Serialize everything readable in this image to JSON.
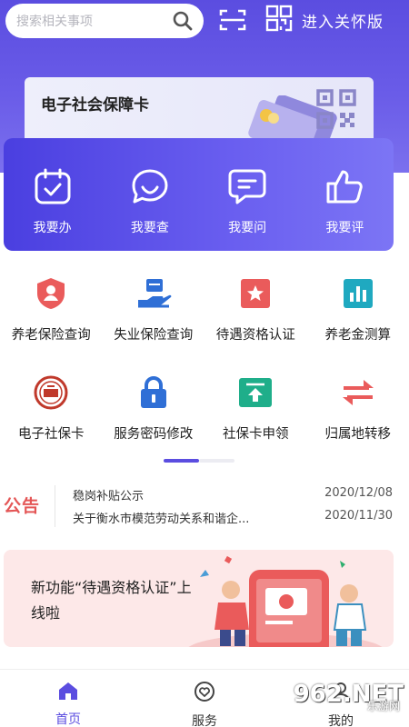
{
  "header": {
    "search_placeholder": "搜索相关事项",
    "care_mode_label": "进入关怀版"
  },
  "card": {
    "title": "电子社会保障卡"
  },
  "actions": [
    {
      "label": "我要办",
      "icon": "calendar-check-icon"
    },
    {
      "label": "我要查",
      "icon": "search-chat-icon"
    },
    {
      "label": "我要问",
      "icon": "message-icon"
    },
    {
      "label": "我要评",
      "icon": "thumbs-up-icon"
    }
  ],
  "services": [
    {
      "label": "养老保险查询",
      "icon": "shield-person-icon",
      "color": "#ea5b5b"
    },
    {
      "label": "失业保险查询",
      "icon": "hand-card-icon",
      "color": "#2f6fd6"
    },
    {
      "label": "待遇资格认证",
      "icon": "star-badge-icon",
      "color": "#ea5b5b"
    },
    {
      "label": "养老金测算",
      "icon": "bar-chart-icon",
      "color": "#1fa9c0"
    },
    {
      "label": "电子社保卡",
      "icon": "seal-icon",
      "color": "#c0392b"
    },
    {
      "label": "服务密码修改",
      "icon": "lock-icon",
      "color": "#2f6fd6"
    },
    {
      "label": "社保卡申领",
      "icon": "upload-card-icon",
      "color": "#1fae8a"
    },
    {
      "label": "归属地转移",
      "icon": "transfer-arrows-icon",
      "color": "#ea5b5b"
    }
  ],
  "notice": {
    "badge": "公告",
    "items": [
      {
        "title": "稳岗补贴公示",
        "date": "2020/12/08"
      },
      {
        "title": "关于衡水市模范劳动关系和谐企...",
        "date": "2020/11/30"
      }
    ]
  },
  "banner": {
    "text": "新功能“待遇资格认证”上线啦"
  },
  "tabbar": [
    {
      "label": "首页",
      "icon": "home-icon",
      "active": true
    },
    {
      "label": "服务",
      "icon": "heart-circle-icon",
      "active": false
    },
    {
      "label": "我的",
      "icon": "person-icon",
      "active": false
    }
  ],
  "watermark": {
    "text": "962.NET",
    "sub": "乐游网"
  },
  "colors": {
    "primary": "#5b4de0",
    "notice_red": "#e45656",
    "banner_bg": "#fde8e8"
  }
}
